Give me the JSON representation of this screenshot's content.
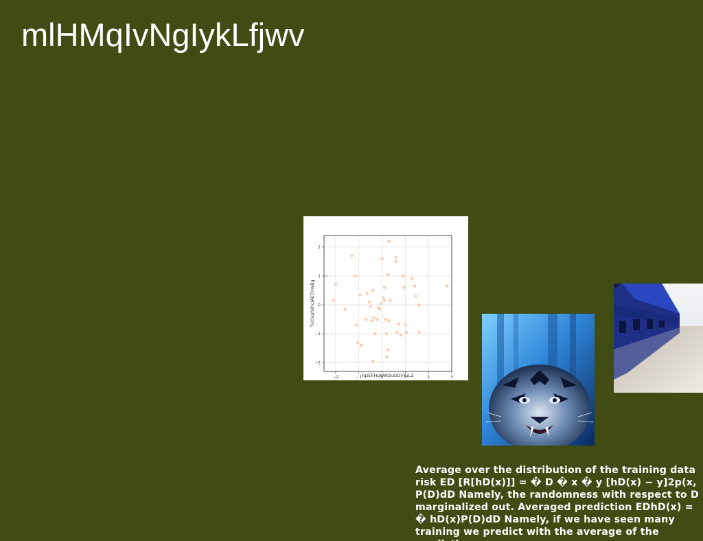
{
  "page": {
    "title": "mlHMqIvNgIykLfjwv",
    "caption": "Average over the distribution of the training data risk ED [R[hD(x)]] = � D � x � y [hD(x) − y]2p(x, P(D)dD Namely, the randomness with respect to D marginalized out. Averaged prediction EDhD(x) = � hD(x)P(D)dD Namely, if we have seen many training we predict with the average of the prediction"
  },
  "images": {
    "tiger": "tiger-photo",
    "boathouse": "boathouse-photo"
  },
  "chart_data": {
    "type": "scatter",
    "title": "",
    "xlabel": "lqzEFHphWDuGDvYuLZ",
    "ylabel": "TxCVpfsIhcJAETHwBg",
    "xlim": [
      -2.5,
      3
    ],
    "ylim": [
      -2.3,
      2.4
    ],
    "xticks": [
      -2,
      -1,
      0,
      1,
      2,
      3
    ],
    "yticks": [
      -2,
      -1,
      0,
      1,
      2
    ],
    "grid": true,
    "marker_color": "#f5c8a8",
    "points": [
      [
        -2.4,
        1.0
      ],
      [
        -2.0,
        0.7
      ],
      [
        -2.1,
        0.15
      ],
      [
        -1.6,
        -0.15
      ],
      [
        -1.3,
        1.7
      ],
      [
        -1.15,
        1.0
      ],
      [
        -1.1,
        -0.7
      ],
      [
        -1.05,
        -1.3
      ],
      [
        -0.9,
        -1.4
      ],
      [
        -0.95,
        0.35
      ],
      [
        -0.7,
        -0.5
      ],
      [
        -0.65,
        0.4
      ],
      [
        -0.55,
        0.1
      ],
      [
        -0.5,
        -0.05
      ],
      [
        -0.4,
        0.5
      ],
      [
        -0.45,
        -0.55
      ],
      [
        -0.35,
        -0.45
      ],
      [
        -0.3,
        -1.0
      ],
      [
        -0.2,
        -0.5
      ],
      [
        -0.15,
        -0.1
      ],
      [
        -0.1,
        -0.15
      ],
      [
        -0.05,
        0.05
      ],
      [
        0.0,
        1.6
      ],
      [
        0.05,
        0.25
      ],
      [
        0.1,
        0.15
      ],
      [
        0.1,
        0.6
      ],
      [
        0.15,
        -0.5
      ],
      [
        0.2,
        -1.0
      ],
      [
        0.25,
        1.05
      ],
      [
        0.3,
        2.2
      ],
      [
        0.35,
        0.15
      ],
      [
        0.3,
        -0.55
      ],
      [
        0.25,
        -1.55
      ],
      [
        0.2,
        -1.8
      ],
      [
        0.6,
        1.65
      ],
      [
        0.6,
        1.5
      ],
      [
        0.7,
        -0.65
      ],
      [
        0.65,
        -0.95
      ],
      [
        0.8,
        -1.05
      ],
      [
        0.9,
        1.0
      ],
      [
        0.95,
        0.6
      ],
      [
        1.0,
        -0.7
      ],
      [
        1.05,
        -0.95
      ],
      [
        1.3,
        0.9
      ],
      [
        1.4,
        0.65
      ],
      [
        1.45,
        0.3
      ],
      [
        1.6,
        0.0
      ],
      [
        1.6,
        -0.95
      ],
      [
        2.8,
        0.65
      ],
      [
        -0.4,
        -1.95
      ]
    ]
  }
}
